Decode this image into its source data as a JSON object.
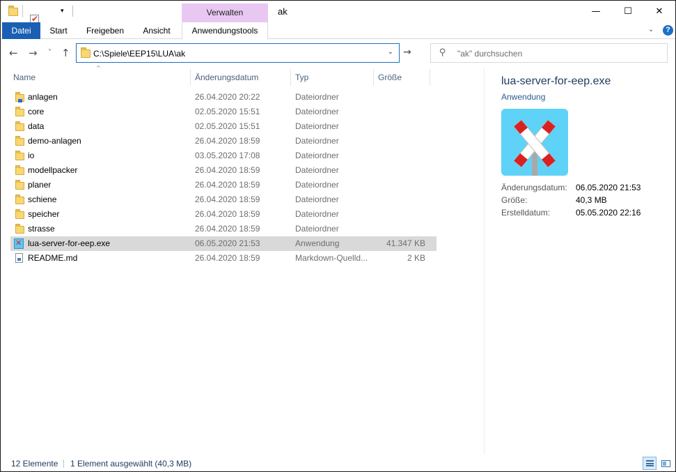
{
  "window": {
    "title": "ak",
    "context_tab_header": "Verwalten",
    "controls": {
      "minimize": "—",
      "maximize": "☐",
      "close": "✕"
    }
  },
  "quick_access": {
    "customize_arrow": "▾"
  },
  "ribbon": {
    "tabs": [
      "Datei",
      "Start",
      "Freigeben",
      "Ansicht",
      "Anwendungstools"
    ],
    "collapse_icon": "chevron-down-icon",
    "help_label": "?"
  },
  "navigation": {
    "back": "←",
    "forward": "→",
    "recent": "˅",
    "up": "↑",
    "address": "C:\\Spiele\\EEP15\\LUA\\ak",
    "refresh": "→",
    "search_placeholder": "\"ak\" durchsuchen"
  },
  "columns": {
    "name": "Name",
    "date": "Änderungsdatum",
    "type": "Typ",
    "size": "Größe",
    "sort_indicator": "^"
  },
  "files": [
    {
      "name": "anlagen",
      "date": "26.04.2020 20:22",
      "type": "Dateiordner",
      "size": "",
      "icon": "folder-lua"
    },
    {
      "name": "core",
      "date": "02.05.2020 15:51",
      "type": "Dateiordner",
      "size": "",
      "icon": "folder"
    },
    {
      "name": "data",
      "date": "02.05.2020 15:51",
      "type": "Dateiordner",
      "size": "",
      "icon": "folder"
    },
    {
      "name": "demo-anlagen",
      "date": "26.04.2020 18:59",
      "type": "Dateiordner",
      "size": "",
      "icon": "folder"
    },
    {
      "name": "io",
      "date": "03.05.2020 17:08",
      "type": "Dateiordner",
      "size": "",
      "icon": "folder"
    },
    {
      "name": "modellpacker",
      "date": "26.04.2020 18:59",
      "type": "Dateiordner",
      "size": "",
      "icon": "folder"
    },
    {
      "name": "planer",
      "date": "26.04.2020 18:59",
      "type": "Dateiordner",
      "size": "",
      "icon": "folder"
    },
    {
      "name": "schiene",
      "date": "26.04.2020 18:59",
      "type": "Dateiordner",
      "size": "",
      "icon": "folder"
    },
    {
      "name": "speicher",
      "date": "26.04.2020 18:59",
      "type": "Dateiordner",
      "size": "",
      "icon": "folder"
    },
    {
      "name": "strasse",
      "date": "26.04.2020 18:59",
      "type": "Dateiordner",
      "size": "",
      "icon": "folder"
    },
    {
      "name": "lua-server-for-eep.exe",
      "date": "06.05.2020 21:53",
      "type": "Anwendung",
      "size": "41.347 KB",
      "icon": "exe",
      "selected": true
    },
    {
      "name": "README.md",
      "date": "26.04.2020 18:59",
      "type": "Markdown-Quelld...",
      "size": "2 KB",
      "icon": "document"
    }
  ],
  "details": {
    "title": "lua-server-for-eep.exe",
    "type": "Anwendung",
    "properties": [
      {
        "key": "Änderungsdatum:",
        "value": "06.05.2020 21:53"
      },
      {
        "key": "Größe:",
        "value": "40,3 MB"
      },
      {
        "key": "Erstelldatum:",
        "value": "05.05.2020 22:16"
      }
    ]
  },
  "status": {
    "count": "12 Elemente",
    "selection": "1 Element ausgewählt (40,3 MB)"
  },
  "colors": {
    "accent": "#1a5fb4",
    "context_tab": "#e8c8f2",
    "selection": "#d9d9d9",
    "app_icon_bg": "#5ed2f7",
    "app_icon_cross": "#d92121"
  }
}
